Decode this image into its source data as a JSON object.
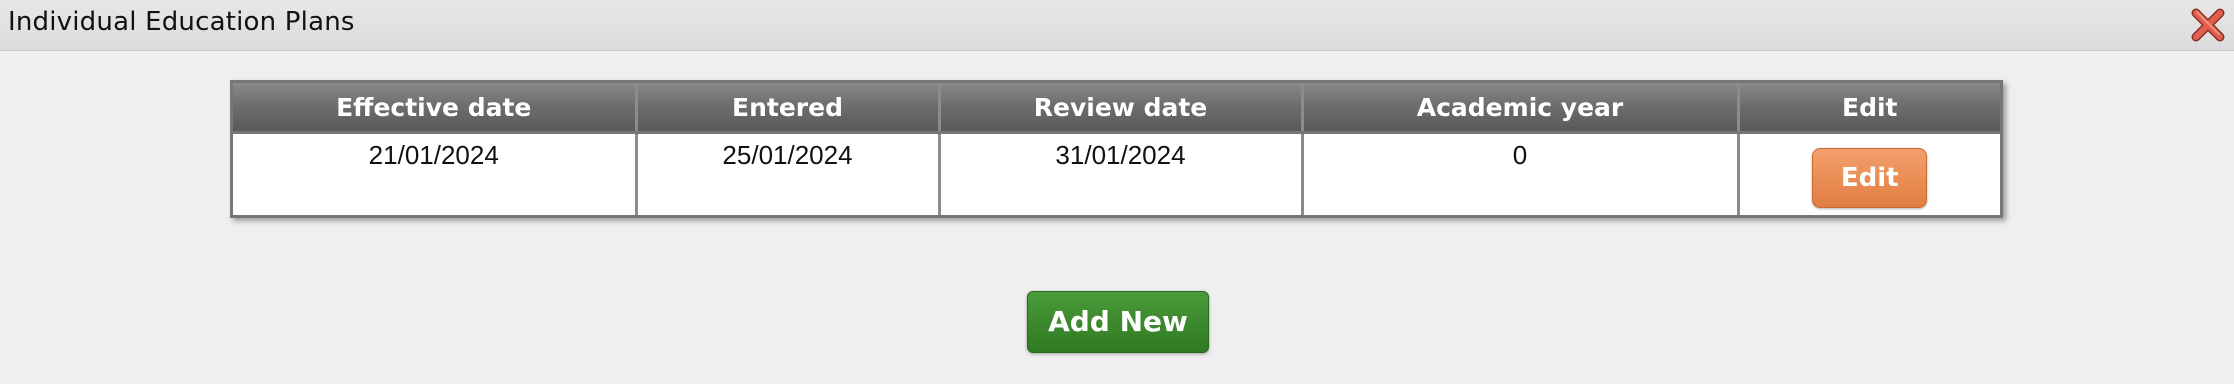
{
  "window": {
    "title": "Individual Education Plans",
    "close_icon": "close-x-icon",
    "close_color": "#d9584a"
  },
  "table": {
    "headers": [
      "Effective date",
      "Entered",
      "Review date",
      "Academic year",
      "Edit"
    ],
    "rows": [
      {
        "effective_date": "21/01/2024",
        "entered": "25/01/2024",
        "review_date": "31/01/2024",
        "academic_year": "0",
        "edit_label": "Edit"
      }
    ]
  },
  "actions": {
    "add_new_label": "Add New"
  },
  "colors": {
    "header_bg": "#6e6e6e",
    "edit_button": "#e8874c",
    "add_button": "#3a8a2c",
    "page_bg": "#efefef"
  }
}
